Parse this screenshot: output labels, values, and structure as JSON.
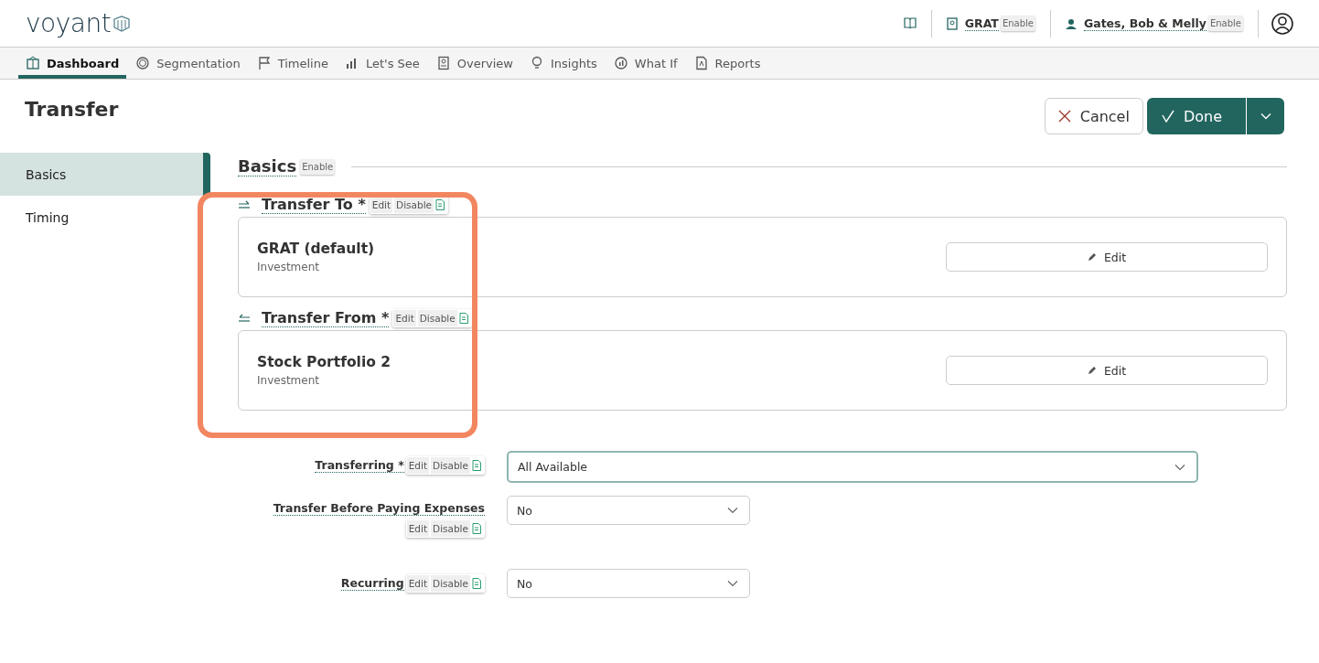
{
  "logo": "voyant",
  "header_items": [
    {
      "kind": "plan",
      "label": "GRAT",
      "badge": "Enable"
    },
    {
      "kind": "client",
      "label": "Gates, Bob & Melly",
      "badge": "Enable"
    }
  ],
  "tabs": [
    {
      "kind": "dashboard",
      "label": "Dashboard",
      "selected": true
    },
    {
      "kind": "segmentation",
      "label": "Segmentation",
      "selected": false
    },
    {
      "kind": "timeline",
      "label": "Timeline",
      "selected": false
    },
    {
      "kind": "letssee",
      "label": "Let's See",
      "selected": false
    },
    {
      "kind": "overview",
      "label": "Overview",
      "selected": false
    },
    {
      "kind": "insights",
      "label": "Insights",
      "selected": false
    },
    {
      "kind": "whatif",
      "label": "What If",
      "selected": false
    },
    {
      "kind": "reports",
      "label": "Reports",
      "selected": false
    }
  ],
  "page_title": "Transfer",
  "actions": {
    "cancel": "Cancel",
    "done": "Done"
  },
  "side_nav": [
    {
      "label": "Basics",
      "selected": true
    },
    {
      "label": "Timing",
      "selected": false
    }
  ],
  "section": {
    "title": "Basics",
    "badge": "Enable"
  },
  "transfers": [
    {
      "kind": "to",
      "label": "Transfer To *",
      "tools": [
        "Edit",
        "Disable"
      ],
      "name": "GRAT (default)",
      "type": "Investment",
      "button": "Edit"
    },
    {
      "kind": "from",
      "label": "Transfer From *",
      "tools": [
        "Edit",
        "Disable"
      ],
      "name": "Stock Portfolio 2",
      "type": "Investment",
      "button": "Edit"
    }
  ],
  "fields": [
    {
      "label": "Transferring *",
      "tools": [
        "Edit",
        "Disable"
      ],
      "value": "All Available",
      "focused": true,
      "kind": "wide"
    },
    {
      "label": "Transfer Before Paying Expenses",
      "tools": [
        "Edit",
        "Disable"
      ],
      "value": "No",
      "focused": false,
      "kind": "narrow"
    },
    {
      "label": "Recurring",
      "tools": [
        "Edit",
        "Disable"
      ],
      "value": "No",
      "focused": false,
      "kind": "narrow"
    }
  ]
}
